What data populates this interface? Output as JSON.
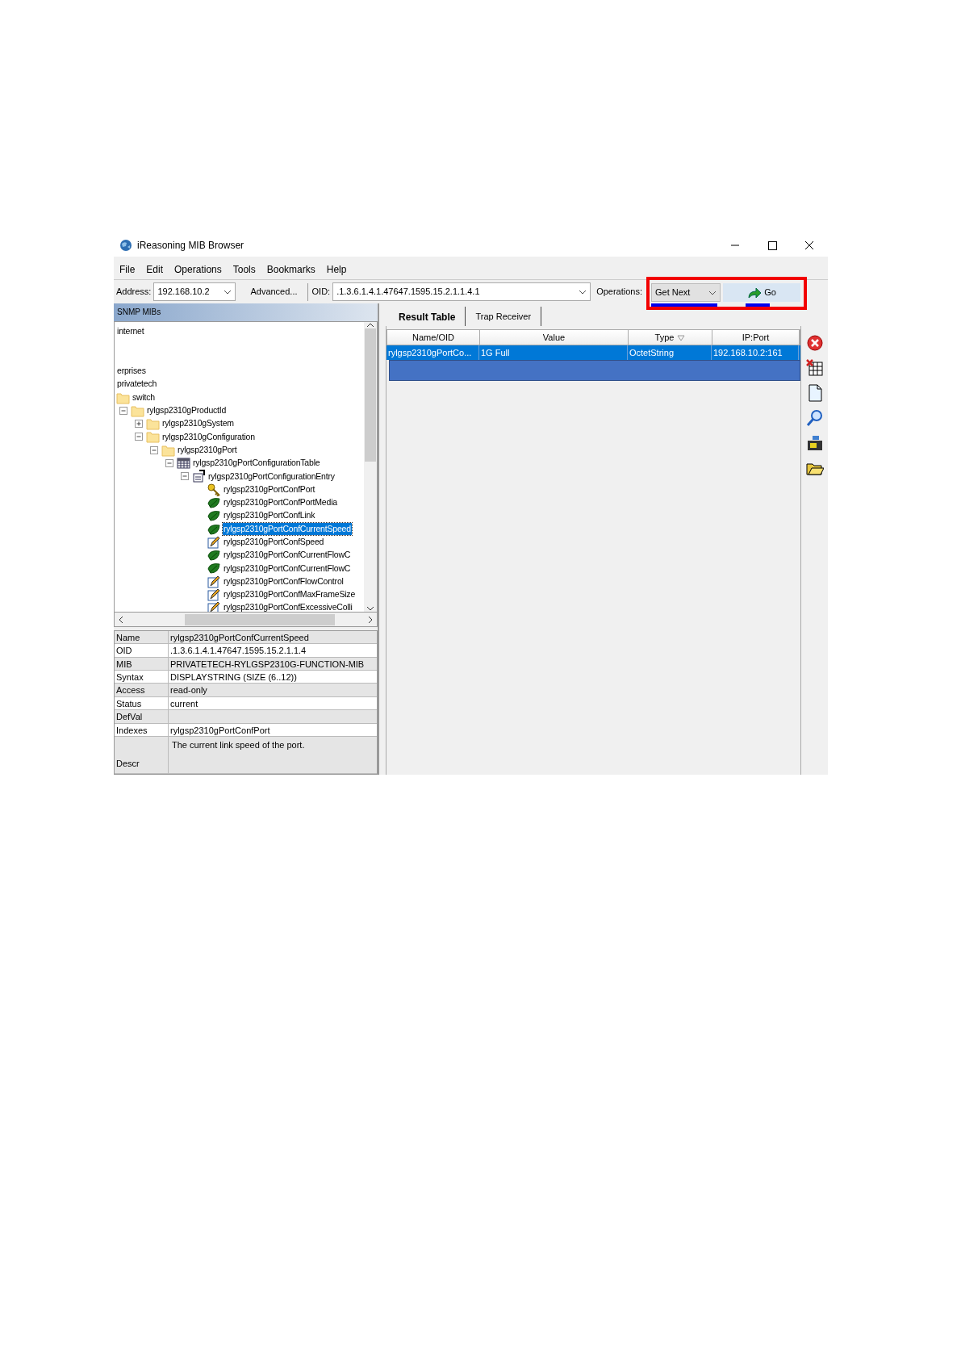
{
  "window": {
    "title": "iReasoning MIB Browser"
  },
  "menu": [
    "File",
    "Edit",
    "Operations",
    "Tools",
    "Bookmarks",
    "Help"
  ],
  "toolbar": {
    "address_label": "Address:",
    "address": "192.168.10.2",
    "advanced": "Advanced...",
    "oid_label": "OID:",
    "oid": ".1.3.6.1.4.1.47647.1595.15.2.1.1.4.1",
    "operations_label": "Operations:",
    "operation": "Get Next",
    "go": "Go",
    "highlighted": true
  },
  "mib_tree": {
    "title": "SNMP MIBs",
    "nodes": [
      {
        "label": "internet",
        "selected": false
      },
      {
        "label": "erprises",
        "selected": false
      },
      {
        "label": "privatetech",
        "selected": false
      },
      {
        "label": "switch",
        "kind": "folder",
        "selected": false,
        "children": [
          {
            "label": "rylgsp2310gProductId",
            "kind": "folder",
            "expanded": true,
            "selected": false,
            "children": [
              {
                "label": "rylgsp2310gSystem",
                "kind": "folder",
                "expanded": false,
                "selected": false
              },
              {
                "label": "rylgsp2310gConfiguration",
                "kind": "folder",
                "expanded": true,
                "selected": false,
                "children": [
                  {
                    "label": "rylgsp2310gPort",
                    "kind": "folder",
                    "expanded": true,
                    "selected": false,
                    "children": [
                      {
                        "label": "rylgsp2310gPortConfigurationTable",
                        "kind": "table",
                        "expanded": true,
                        "selected": false,
                        "children": [
                          {
                            "label": "rylgsp2310gPortConfigurationEntry",
                            "kind": "entry",
                            "expanded": true,
                            "selected": false,
                            "children": [
                              {
                                "label": "rylgsp2310gPortConfPort",
                                "kind": "key",
                                "selected": false
                              },
                              {
                                "label": "rylgsp2310gPortConfPortMedia",
                                "kind": "leaf",
                                "selected": false
                              },
                              {
                                "label": "rylgsp2310gPortConfLink",
                                "kind": "leaf",
                                "selected": false
                              },
                              {
                                "label": "rylgsp2310gPortConfCurrentSpeed",
                                "kind": "leaf",
                                "selected": true
                              },
                              {
                                "label": "rylgsp2310gPortConfSpeed",
                                "kind": "pencil",
                                "selected": false
                              },
                              {
                                "label": "rylgsp2310gPortConfCurrentFlowC",
                                "kind": "leaf",
                                "selected": false
                              },
                              {
                                "label": "rylgsp2310gPortConfCurrentFlowC",
                                "kind": "leaf",
                                "selected": false
                              },
                              {
                                "label": "rylgsp2310gPortConfFlowControl",
                                "kind": "pencil",
                                "selected": false
                              },
                              {
                                "label": "rylgsp2310gPortConfMaxFrameSize",
                                "kind": "pencil",
                                "selected": false
                              },
                              {
                                "label": "rylgsp2310gPortConfExcessiveColli",
                                "kind": "pencil",
                                "selected": false
                              }
                            ]
                          }
                        ]
                      }
                    ]
                  }
                ]
              }
            ]
          }
        ]
      }
    ]
  },
  "properties": [
    {
      "key": "Name",
      "value": "rylgsp2310gPortConfCurrentSpeed"
    },
    {
      "key": "OID",
      "value": ".1.3.6.1.4.1.47647.1595.15.2.1.1.4"
    },
    {
      "key": "MIB",
      "value": "PRIVATETECH-RYLGSP2310G-FUNCTION-MIB"
    },
    {
      "key": "Syntax",
      "value": "DISPLAYSTRING (SIZE (6..12))"
    },
    {
      "key": "Access",
      "value": "read-only"
    },
    {
      "key": "Status",
      "value": "current"
    },
    {
      "key": "DefVal"
    },
    {
      "key": "Indexes",
      "value": "rylgsp2310gPortConfPort"
    },
    {
      "key": "Descr",
      "value": "The current link speed of the port.",
      "kind": "text"
    }
  ],
  "tabs": [
    {
      "label": "Result Table",
      "selected": true
    },
    {
      "label": "Trap Receiver",
      "selected": false
    }
  ],
  "result_table": {
    "columns": [
      "Name/OID",
      "Value",
      "Type",
      "IP:Port"
    ],
    "rows": [
      {
        "cells": [
          "rylgsp2310gPortCo...",
          "1G Full",
          "OctetString",
          "192.168.10.2:161"
        ],
        "selected": true
      }
    ]
  }
}
